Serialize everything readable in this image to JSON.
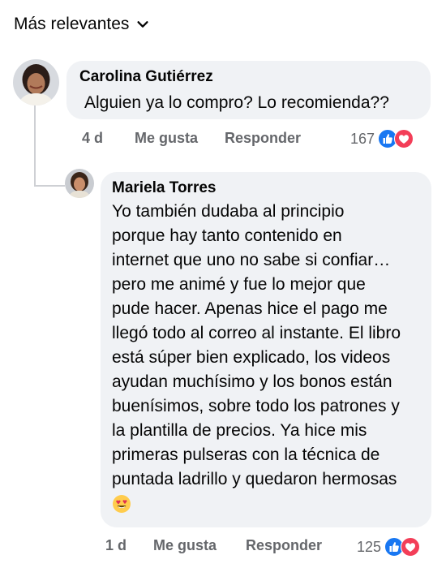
{
  "sort": {
    "label": "Más relevantes"
  },
  "comments": [
    {
      "author": "Carolina Gutiérrez",
      "text": "Alguien ya lo compro? Lo recomienda??",
      "time": "4 d",
      "like_label": "Me gusta",
      "reply_label": "Responder",
      "reaction_count": "167"
    },
    {
      "author": "Mariela Torres",
      "text_lines": [
        "Yo también dudaba al principio",
        "porque hay tanto contenido en",
        "internet que uno no sabe si confiar…",
        "pero me animé y fue lo mejor que",
        "pude hacer. Apenas hice el pago me",
        "llegó todo al correo al instante. El libro",
        "está súper bien explicado, los videos",
        "ayudan muchísimo y los bonos están",
        "buenísimos, sobre todo los patrones y",
        "la plantilla de precios. Ya hice mis",
        "primeras pulseras con la técnica de",
        "puntada ladrillo y quedaron hermosas"
      ],
      "time": "1 d",
      "like_label": "Me gusta",
      "reply_label": "Responder",
      "reaction_count": "125"
    }
  ],
  "colors": {
    "like_blue": "#1877f2",
    "love_red": "#f33e58",
    "meta_gray": "#65676b",
    "bubble_bg": "#f0f2f5"
  },
  "icons": {
    "sort": "chevron-down-icon",
    "like": "like-reaction-icon",
    "love": "love-reaction-icon",
    "emoji": "heart-eyes-emoji"
  }
}
